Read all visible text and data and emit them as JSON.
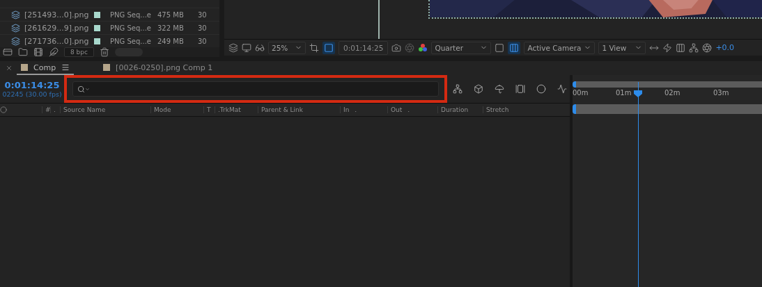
{
  "project": {
    "rows": [
      {
        "name": "[251493...0].png",
        "type": "PNG Seq...e",
        "size": "475 MB",
        "fps": "30"
      },
      {
        "name": "[261629...9].png",
        "type": "PNG Seq...e",
        "size": "322 MB",
        "fps": "30"
      },
      {
        "name": "[271736...0].png",
        "type": "PNG Seq...e",
        "size": "249 MB",
        "fps": "30"
      }
    ],
    "bit_depth": "8 bpc"
  },
  "viewer": {
    "zoom": "25%",
    "timecode": "0:01:14:25",
    "resolution": "Quarter",
    "camera": "Active Camera",
    "views": "1 View",
    "exposure": "+0.0",
    "mask_active": true,
    "transparency_grid": true
  },
  "timeline": {
    "tabs": [
      {
        "label": "Comp",
        "selected": true,
        "color": "#b5a58a"
      },
      {
        "label": "[0026-0250].png Comp 1",
        "selected": false,
        "color": "#b5a58a"
      }
    ],
    "timecode": "0:01:14:25",
    "frame_info": "02245 (30.00 fps)",
    "search": {
      "highlighted": true
    },
    "columns": [
      {
        "label": "#"
      },
      {
        "label": "."
      },
      {
        "label": "Source Name"
      },
      {
        "label": "Mode"
      },
      {
        "label": "T"
      },
      {
        "label": ".TrkMat"
      },
      {
        "label": "Parent & Link"
      },
      {
        "label": "In",
        "mark": "."
      },
      {
        "label": "Out",
        "mark": "."
      },
      {
        "label": "Duration"
      },
      {
        "label": "Stretch"
      }
    ],
    "ruler": [
      "00m",
      "01m",
      "02m",
      "03m"
    ]
  }
}
